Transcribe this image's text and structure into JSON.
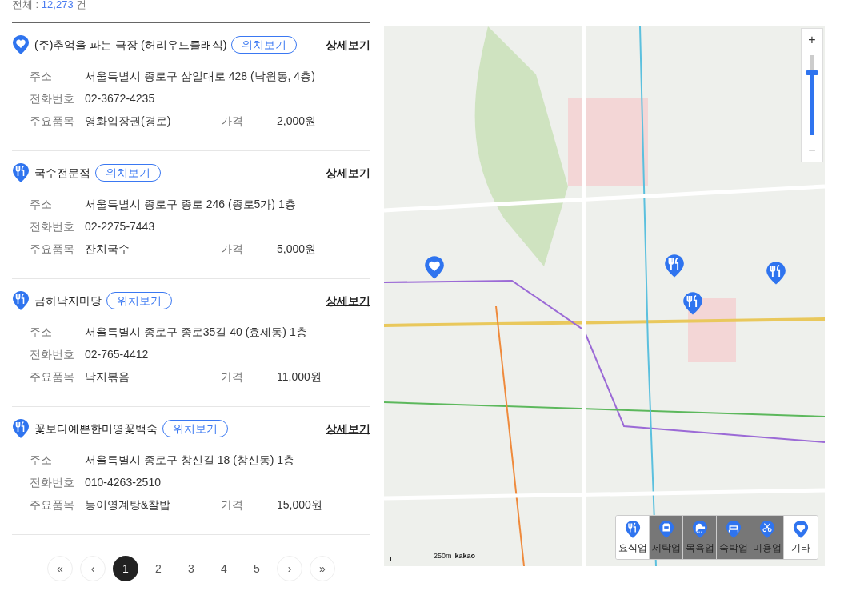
{
  "summary": {
    "label": "전체 :",
    "count": "12,273",
    "unit": "건"
  },
  "places": [
    {
      "kind": "heart",
      "name": "(주)추억을 파는 극장 (허리우드클래식)",
      "locate": "위치보기",
      "detail": "상세보기",
      "fields": [
        {
          "label": "주소",
          "value": "서울특별시 종로구 삼일대로 428 (낙원동, 4층)"
        },
        {
          "label": "전화번호",
          "value": "02-3672-4235"
        }
      ],
      "item_label": "주요품목",
      "item": "영화입장권(경로)",
      "price_label": "가격",
      "price": "2,000원"
    },
    {
      "kind": "food",
      "name": "국수전문점",
      "locate": "위치보기",
      "detail": "상세보기",
      "fields": [
        {
          "label": "주소",
          "value": "서울특별시 종로구 종로 246 (종로5가) 1층"
        },
        {
          "label": "전화번호",
          "value": "02-2275-7443"
        }
      ],
      "item_label": "주요품목",
      "item": "잔치국수",
      "price_label": "가격",
      "price": "5,000원"
    },
    {
      "kind": "food",
      "name": "금하낙지마당",
      "locate": "위치보기",
      "detail": "상세보기",
      "fields": [
        {
          "label": "주소",
          "value": "서울특별시 종로구 종로35길 40 (효제동) 1층"
        },
        {
          "label": "전화번호",
          "value": "02-765-4412"
        }
      ],
      "item_label": "주요품목",
      "item": "낙지볶음",
      "price_label": "가격",
      "price": "11,000원"
    },
    {
      "kind": "food",
      "name": "꽃보다예쁜한미영꽃백숙",
      "locate": "위치보기",
      "detail": "상세보기",
      "fields": [
        {
          "label": "주소",
          "value": "서울특별시 종로구 창신길 18 (창신동) 1층"
        },
        {
          "label": "전화번호",
          "value": "010-4263-2510"
        }
      ],
      "item_label": "주요품목",
      "item": "능이영계탕&찰밥",
      "price_label": "가격",
      "price": "15,000원"
    }
  ],
  "pagination": {
    "first": "«",
    "prev": "‹",
    "pages": [
      {
        "label": "1",
        "selected": true
      },
      {
        "label": "2",
        "selected": false
      },
      {
        "label": "3",
        "selected": false
      },
      {
        "label": "4",
        "selected": false
      },
      {
        "label": "5",
        "selected": false
      }
    ],
    "next": "›",
    "last": "»"
  },
  "map": {
    "zoom_in": "+",
    "zoom_out": "−",
    "zoom": {
      "level": 0.78
    },
    "scale": "250m",
    "brand": "kakao",
    "categories": [
      {
        "kind": "food",
        "label": "요식업",
        "selected": true
      },
      {
        "kind": "laundry",
        "label": "세탁업",
        "selected": false
      },
      {
        "kind": "bath",
        "label": "목욕업",
        "selected": false
      },
      {
        "kind": "lodging",
        "label": "숙박업",
        "selected": false
      },
      {
        "kind": "beauty",
        "label": "미용업",
        "selected": false
      },
      {
        "kind": "heart",
        "label": "기타",
        "selected": true
      }
    ]
  }
}
